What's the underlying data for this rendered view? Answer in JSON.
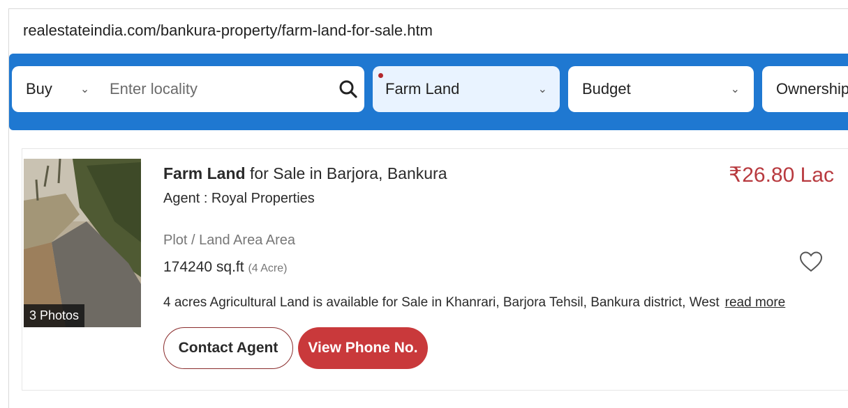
{
  "browser": {
    "url": "realestateindia.com/bankura-property/farm-land-for-sale.htm"
  },
  "search": {
    "mode": "Buy",
    "placeholder": "Enter locality",
    "property_type": "Farm Land",
    "budget": "Budget",
    "ownership": "Ownership"
  },
  "listing": {
    "title_bold": "Farm Land",
    "title_rest": " for Sale in Barjora, Bankura",
    "agent": "Agent : Royal Properties",
    "price": "₹26.80 Lac",
    "area_label": "Plot / Land Area Area",
    "area_value": "174240 sq.ft",
    "area_alt": "(4 Acre)",
    "description": "4 acres Agricultural Land is available for Sale in Khanrari, Barjora Tehsil, Bankura district, West",
    "read_more": "read more",
    "photo_count": "3 Photos",
    "contact_label": "Contact Agent",
    "phone_label": "View Phone No."
  },
  "colors": {
    "search_bar": "#1f78d1",
    "price": "#b83a3f",
    "phone_button": "#c9393b"
  }
}
